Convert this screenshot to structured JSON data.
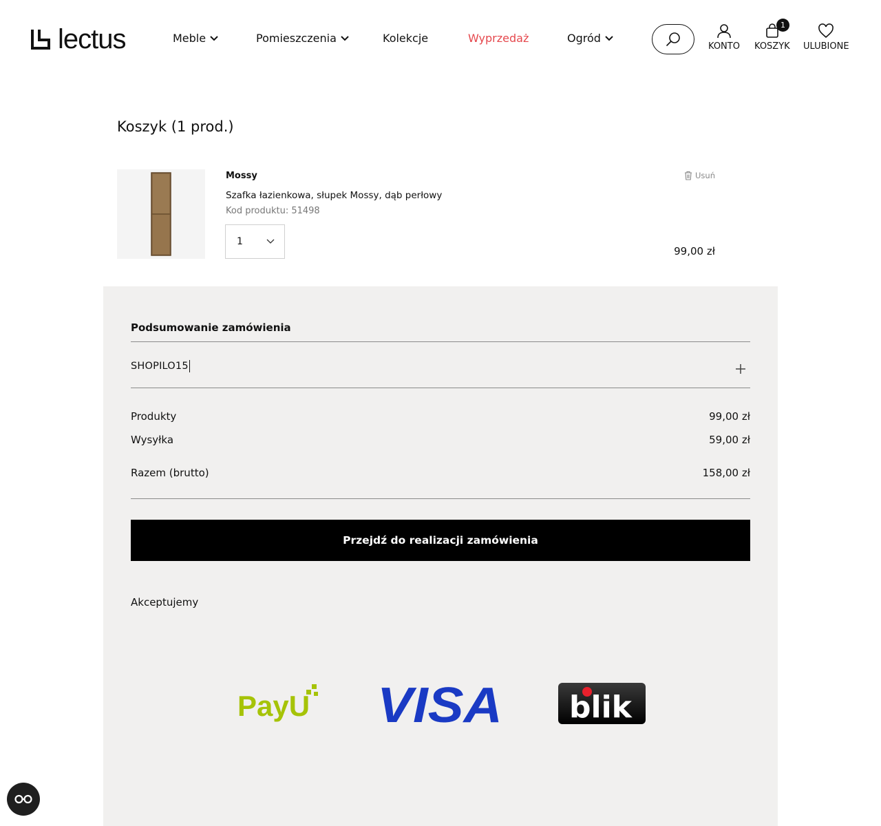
{
  "header": {
    "logo_text": "lectus",
    "nav": [
      {
        "label": "Meble",
        "has_dropdown": true
      },
      {
        "label": "Pomieszczenia",
        "has_dropdown": true
      },
      {
        "label": "Kolekcje",
        "has_dropdown": false
      },
      {
        "label": "Wyprzedaż",
        "has_dropdown": false,
        "color": "#e5484d"
      },
      {
        "label": "Ogród",
        "has_dropdown": true
      }
    ],
    "account_label": "KONTO",
    "cart_label": "KOSZYK",
    "cart_count": "1",
    "wishlist_label": "ULUBIONE",
    "icons": [
      "search-icon",
      "user-icon",
      "shopping-bag-icon",
      "heart-icon"
    ]
  },
  "cart": {
    "title": "Koszyk (1 prod.)",
    "item": {
      "brand": "Mossy",
      "name": "Szafka łazienkowa, słupek Mossy, dąb perłowy",
      "code": "Kod produktu: 51498",
      "quantity": "1",
      "price": "99,00 zł",
      "remove_label": "Usuń"
    }
  },
  "summary": {
    "title": "Podsumowanie zamówienia",
    "coupon_value": "SHOPILO15",
    "rows": {
      "products_label": "Produkty",
      "products_value": "99,00 zł",
      "shipping_label": "Wysyłka",
      "shipping_value": "59,00 zł",
      "total_label": "Razem (brutto)",
      "total_value": "158,00 zł"
    },
    "checkout_label": "Przejdź do realizacji zamówienia",
    "accept_label": "Akceptujemy",
    "payment_logos": {
      "payu": "PayU",
      "visa": "VISA",
      "blik": "blik"
    }
  },
  "colors": {
    "sale": "#e5484d",
    "summary_bg": "#f1f0ef",
    "payu_green": "#a6c307",
    "visa_blue": "#1a3ac4",
    "blik_red": "#e8202c"
  }
}
